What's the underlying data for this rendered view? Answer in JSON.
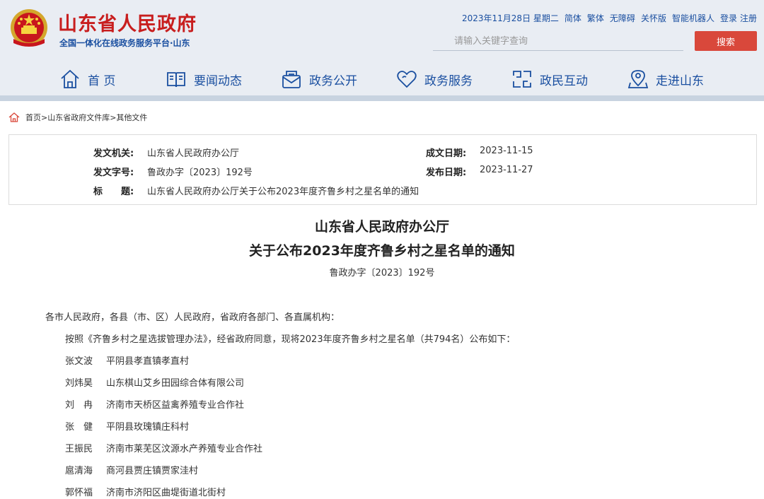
{
  "header": {
    "title": "山东省人民政府",
    "subtitle": "全国一体化在线政务服务平台·山东",
    "top_links": {
      "date": "2023年11月28日 星期二",
      "simplified": "简体",
      "traditional": "繁体",
      "accessible": "无障碍",
      "elderly": "关怀版",
      "robot": "智能机器人",
      "login": "登录",
      "register": "注册"
    },
    "search": {
      "placeholder": "请输入关键字查询",
      "button": "搜索"
    }
  },
  "nav": [
    {
      "label": "首 页",
      "icon": "home-icon"
    },
    {
      "label": "要闻动态",
      "icon": "book-icon"
    },
    {
      "label": "政务公开",
      "icon": "mail-icon"
    },
    {
      "label": "政务服务",
      "icon": "heart-icon"
    },
    {
      "label": "政民互动",
      "icon": "interaction-icon"
    },
    {
      "label": "走进山东",
      "icon": "map-pin-icon"
    }
  ],
  "breadcrumb": "首页>山东省政府文件库>其他文件",
  "info": {
    "issuer_label": "发文机关:",
    "issuer": "山东省人民政府办公厅",
    "docno_label": "发文字号:",
    "docno": "鲁政办字〔2023〕192号",
    "title_label": "标　　题:",
    "title": "山东省人民政府办公厅关于公布2023年度齐鲁乡村之星名单的通知",
    "created_label": "成文日期:",
    "created": "2023-11-15",
    "published_label": "发布日期:",
    "published": "2023-11-27"
  },
  "article": {
    "title_line1": "山东省人民政府办公厅",
    "title_line2": "关于公布2023年度齐鲁乡村之星名单的通知",
    "doc_no": "鲁政办字〔2023〕192号",
    "salutation": "各市人民政府，各县（市、区）人民政府，省政府各部门、各直属机构：",
    "intro": "按照《齐鲁乡村之星选拔管理办法》，经省政府同意，现将2023年度齐鲁乡村之星名单（共794名）公布如下：",
    "people": [
      {
        "name": "张文波",
        "org": "平阴县孝直镇孝直村"
      },
      {
        "name": "刘炜昊",
        "org": "山东棋山艾乡田园综合体有限公司"
      },
      {
        "name": "刘　冉",
        "org": "济南市天桥区益禽养殖专业合作社"
      },
      {
        "name": "张　健",
        "org": "平阴县玫瑰镇庄科村"
      },
      {
        "name": "王振民",
        "org": "济南市莱芜区汶源水产养殖专业合作社"
      },
      {
        "name": "扈清海",
        "org": "商河县贾庄镇贾家洼村"
      },
      {
        "name": "郭怀福",
        "org": "济南市济阳区曲堤街道北街村"
      }
    ]
  },
  "colors": {
    "title_red": "#c81e1e",
    "nav_blue": "#1a4fa0",
    "search_red": "#d9483b",
    "header_bg": "#e9edf3"
  }
}
